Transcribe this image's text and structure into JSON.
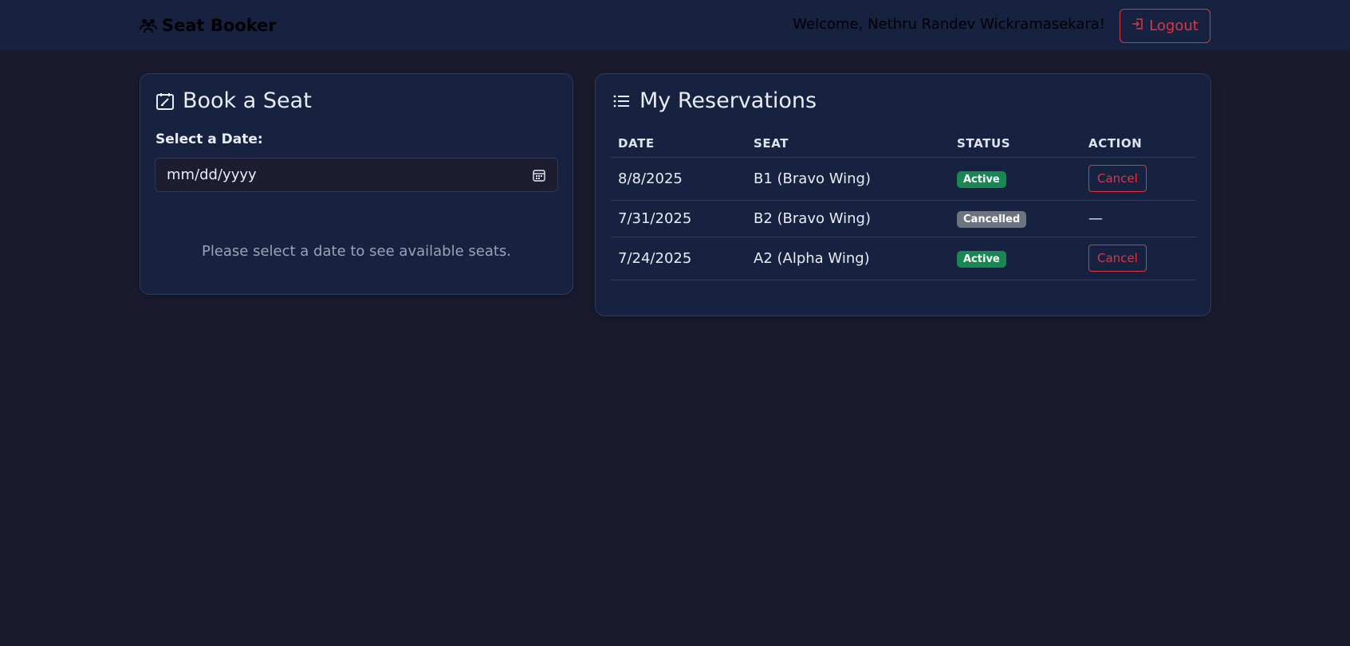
{
  "navbar": {
    "brand": "Seat Booker",
    "welcome": "Welcome, Nethru Randev Wickramasekara!",
    "logout_label": "Logout"
  },
  "book": {
    "title": "Book a Seat",
    "date_label": "Select a Date:",
    "date_placeholder": "mm/dd/yyyy",
    "hint": "Please select a date to see available seats."
  },
  "reservations": {
    "title": "My Reservations",
    "columns": [
      "DATE",
      "SEAT",
      "STATUS",
      "ACTION"
    ],
    "rows": [
      {
        "date": "8/8/2025",
        "seat": "B1 (Bravo Wing)",
        "status": "Active",
        "action": "Cancel"
      },
      {
        "date": "7/31/2025",
        "seat": "B2 (Bravo Wing)",
        "status": "Cancelled",
        "action": "—"
      },
      {
        "date": "7/24/2025",
        "seat": "A2 (Alpha Wing)",
        "status": "Active",
        "action": "Cancel"
      }
    ]
  },
  "colors": {
    "background": "#1a1b2e",
    "card": "#172240",
    "danger": "#dc3545",
    "success": "#198754",
    "secondary": "#6c757d"
  },
  "icons": [
    "users-icon",
    "logout-icon",
    "calendar-check-icon",
    "list-icon",
    "calendar-icon"
  ]
}
